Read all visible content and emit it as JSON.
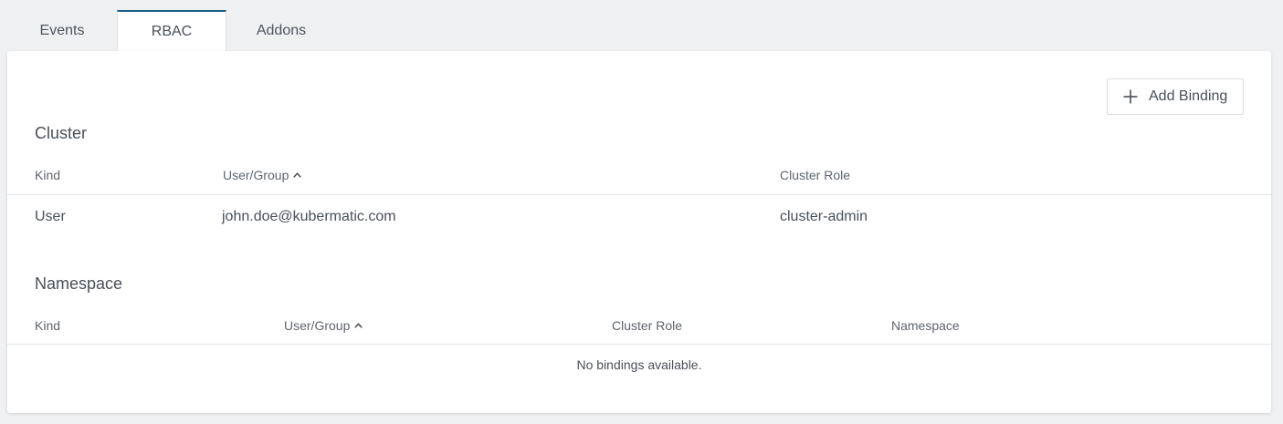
{
  "tabs": [
    {
      "label": "Events"
    },
    {
      "label": "RBAC"
    },
    {
      "label": "Addons"
    }
  ],
  "toolbar": {
    "add_binding_label": "Add Binding",
    "add_binding_icon": "plus-icon"
  },
  "cluster": {
    "title": "Cluster",
    "columns": {
      "kind": "Kind",
      "user_group": "User/Group",
      "cluster_role": "Cluster Role"
    },
    "sorted_column": "user_group",
    "sort_direction": "ascending",
    "rows": [
      {
        "kind": "User",
        "user_group": "john.doe@kubermatic.com",
        "cluster_role": "cluster-admin"
      }
    ]
  },
  "namespace": {
    "title": "Namespace",
    "columns": {
      "kind": "Kind",
      "user_group": "User/Group",
      "cluster_role": "Cluster Role",
      "namespace": "Namespace"
    },
    "sorted_column": "user_group",
    "sort_direction": "ascending",
    "empty_message": "No bindings available."
  },
  "colors": {
    "active_tab_accent": "#1d5e86",
    "page_background": "#eef0f2",
    "card_background": "#ffffff",
    "text": "#4a4f57"
  }
}
